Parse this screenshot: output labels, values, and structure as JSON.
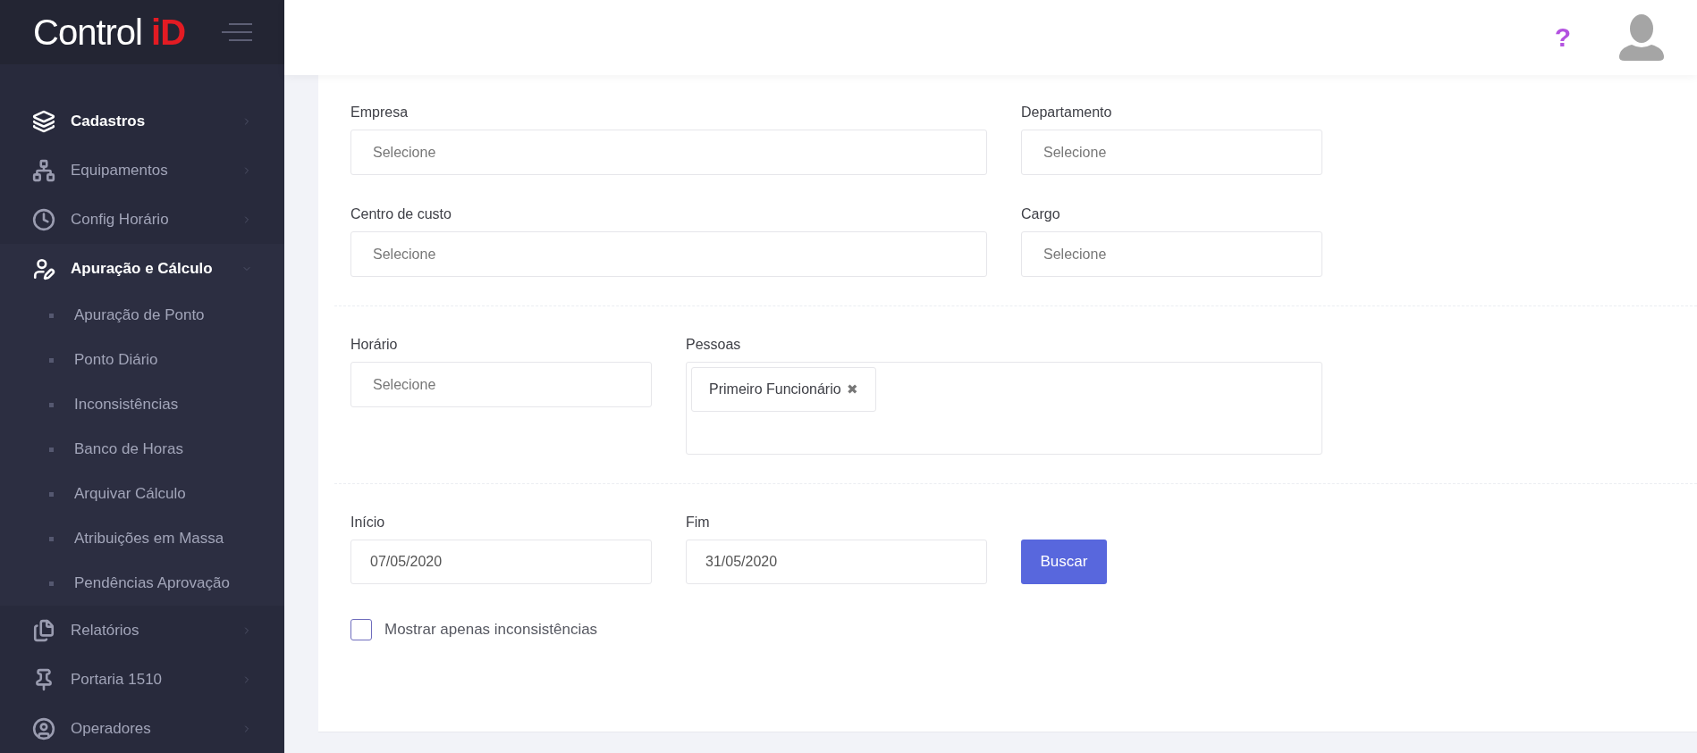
{
  "logo": {
    "text": "Control",
    "accent": "iD"
  },
  "sidebar": {
    "items": [
      {
        "label": "Cadastros",
        "selected": true,
        "expanded": false
      },
      {
        "label": "Equipamentos",
        "selected": false,
        "expanded": false
      },
      {
        "label": "Config Horário",
        "selected": false,
        "expanded": false
      },
      {
        "label": "Apuração e Cálculo",
        "selected": true,
        "expanded": true,
        "children": [
          {
            "label": "Apuração de Ponto"
          },
          {
            "label": "Ponto Diário"
          },
          {
            "label": "Inconsistências"
          },
          {
            "label": "Banco de Horas"
          },
          {
            "label": "Arquivar Cálculo"
          },
          {
            "label": "Atribuições em Massa"
          },
          {
            "label": "Pendências Aprovação"
          }
        ]
      },
      {
        "label": "Relatórios",
        "selected": false,
        "expanded": false
      },
      {
        "label": "Portaria 1510",
        "selected": false,
        "expanded": false
      },
      {
        "label": "Operadores",
        "selected": false,
        "expanded": false
      }
    ]
  },
  "header": {
    "help": "?"
  },
  "form": {
    "empresa": {
      "label": "Empresa",
      "placeholder": "Selecione"
    },
    "departamento": {
      "label": "Departamento",
      "placeholder": "Selecione"
    },
    "centro_de_custo": {
      "label": "Centro de custo",
      "placeholder": "Selecione"
    },
    "cargo": {
      "label": "Cargo",
      "placeholder": "Selecione"
    },
    "horario": {
      "label": "Horário",
      "placeholder": "Selecione"
    },
    "pessoas": {
      "label": "Pessoas",
      "tags": [
        "Primeiro Funcionário"
      ],
      "remove": "✖"
    },
    "inicio": {
      "label": "Início",
      "value": "07/05/2020"
    },
    "fim": {
      "label": "Fim",
      "value": "31/05/2020"
    },
    "search_button": "Buscar",
    "only_inconsistencies": {
      "label": "Mostrar apenas inconsistências",
      "checked": false
    }
  }
}
